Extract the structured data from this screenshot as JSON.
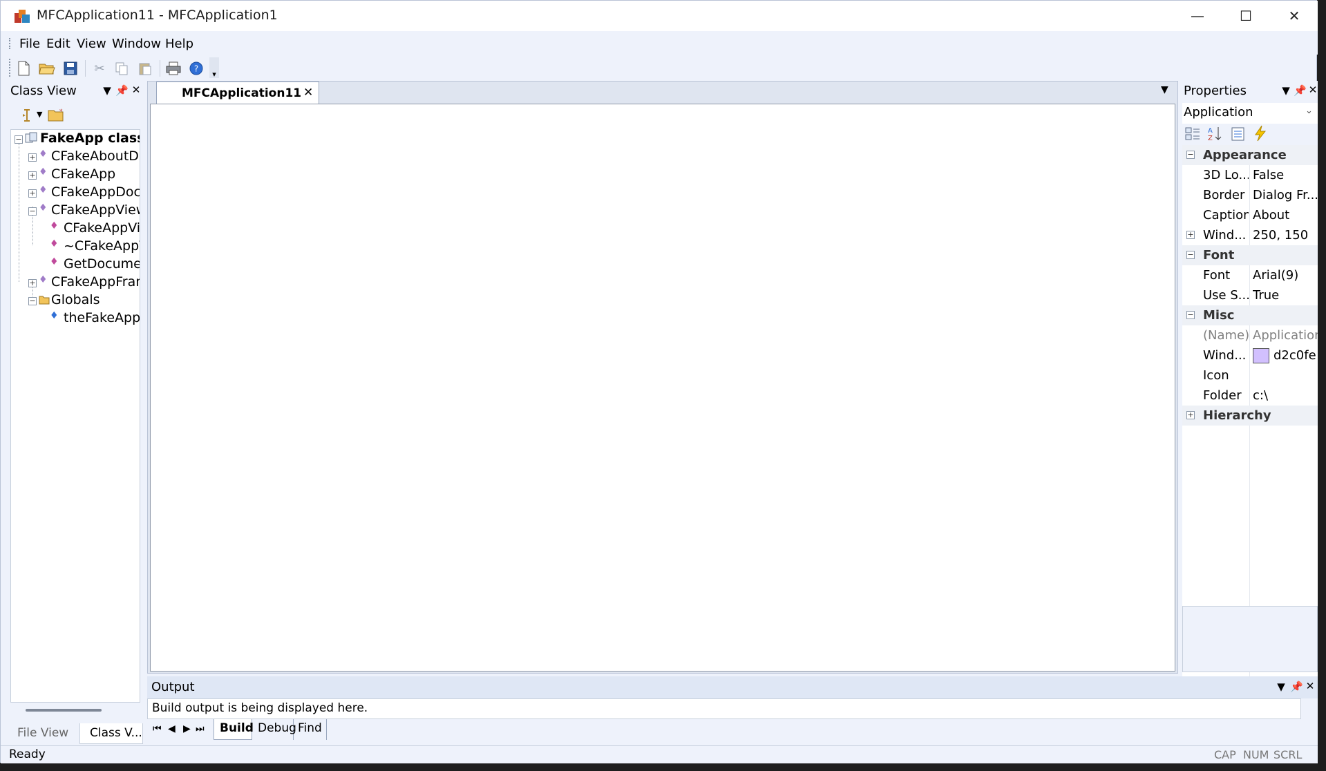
{
  "window": {
    "title": "MFCApplication11 - MFCApplication1",
    "controls": {
      "minimize": "—",
      "maximize": "☐",
      "close": "✕"
    }
  },
  "menu": [
    "File",
    "Edit",
    "View",
    "Window",
    "Help"
  ],
  "toolbar": {
    "icons": [
      "new-file-icon",
      "open-folder-icon",
      "save-icon",
      "cut-icon",
      "copy-icon",
      "paste-icon",
      "print-icon",
      "help-icon"
    ]
  },
  "class_view": {
    "title": "Class View",
    "tree": [
      {
        "label": "FakeApp classes",
        "bold": true
      },
      {
        "label": "CFakeAboutDlg"
      },
      {
        "label": "CFakeApp"
      },
      {
        "label": "CFakeAppDoc"
      },
      {
        "label": "CFakeAppView"
      },
      {
        "label": "CFakeAppView"
      },
      {
        "label": "~CFakeAppView"
      },
      {
        "label": "GetDocument"
      },
      {
        "label": "CFakeAppFrame"
      },
      {
        "label": "Globals"
      },
      {
        "label": "theFakeApp"
      }
    ],
    "tabs": [
      "File View",
      "Class V..."
    ]
  },
  "document": {
    "tab": "MFCApplication11"
  },
  "properties": {
    "title": "Properties",
    "selected": "Application",
    "categories": {
      "appearance": "Appearance",
      "font": "Font",
      "misc": "Misc",
      "hierarchy": "Hierarchy"
    },
    "rows": {
      "r1": {
        "name": "3D Lo...",
        "value": "False"
      },
      "r2": {
        "name": "Border",
        "value": "Dialog Fr..."
      },
      "r3": {
        "name": "Caption",
        "value": "About"
      },
      "r4": {
        "name": "Wind...",
        "value": "250, 150"
      },
      "r5": {
        "name": "Font",
        "value": "Arial(9)"
      },
      "r6": {
        "name": "Use S...",
        "value": "True"
      },
      "r7": {
        "name": "(Name)",
        "value": "Application"
      },
      "r8": {
        "name": "Wind...",
        "value": "d2c0fe"
      },
      "r9": {
        "name": "Icon",
        "value": ""
      },
      "r10": {
        "name": "Folder",
        "value": "c:\\"
      }
    },
    "swatch_color": "#d2c0fe"
  },
  "output": {
    "title": "Output",
    "line1": "Build output is being displayed here.",
    "tabs": [
      "Build",
      "Debug",
      "Find"
    ]
  },
  "status": {
    "text": "Ready",
    "indicators": [
      "CAP",
      "NUM",
      "SCRL"
    ]
  }
}
